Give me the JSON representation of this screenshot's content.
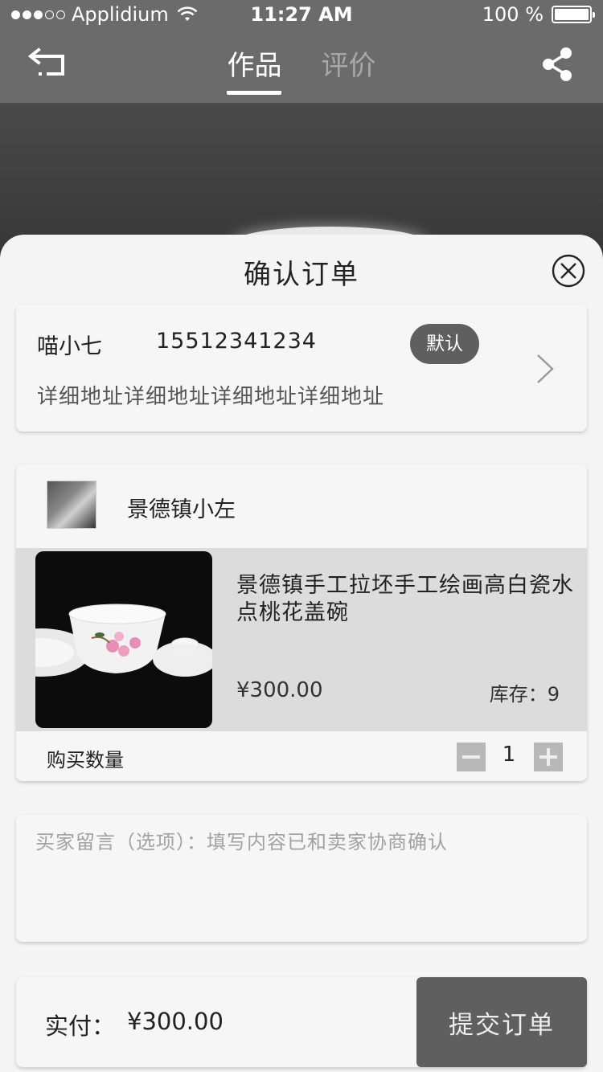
{
  "status_bar": {
    "carrier": "Applidium",
    "time": "11:27 AM",
    "battery": "100 %",
    "signal_bars": 5,
    "signal_filled": 3
  },
  "nav": {
    "tabs": [
      {
        "label": "作品",
        "active": true
      },
      {
        "label": "评价",
        "active": false
      }
    ],
    "back_icon": "back-arrow-icon",
    "share_icon": "share-icon"
  },
  "sheet": {
    "title": "确认订单",
    "close_icon": "close-circle-icon"
  },
  "address": {
    "name": "喵小七",
    "phone": "15512341234",
    "badge": "默认",
    "detail": "详细地址详细地址详细地址详细地址"
  },
  "shop": {
    "name": "景德镇小左"
  },
  "item": {
    "title": "景德镇手工拉坯手工绘画高白瓷水点桃花盖碗",
    "price": "¥300.00",
    "stock": "库存：9"
  },
  "quantity": {
    "label": "购买数量",
    "value": "1"
  },
  "message": {
    "placeholder": "买家留言（选项）：填写内容已和卖家协商确认"
  },
  "footer": {
    "pay_label": "实付：",
    "pay_amount": "¥300.00",
    "submit_label": "提交订单"
  },
  "colors": {
    "nav_background": "#6b6b6b",
    "sheet_background": "#f4f4f4",
    "badge_background": "#5f5f5f",
    "submit_background": "#5f5f5f",
    "item_row_background": "#dcdcdc"
  }
}
